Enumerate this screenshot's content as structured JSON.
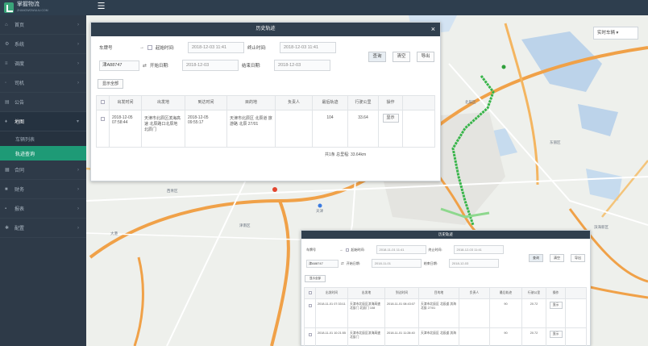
{
  "app": {
    "title": "掌握物流",
    "subtitle": "ZHANGWOWULIU.COM"
  },
  "sidebar": {
    "items": [
      {
        "label": "首页",
        "icon": "home-icon"
      },
      {
        "label": "系统",
        "icon": "gear-icon"
      },
      {
        "label": "调度",
        "icon": "dispatch-icon"
      },
      {
        "label": "司机",
        "icon": "user-icon"
      },
      {
        "label": "公告",
        "icon": "notice-icon"
      },
      {
        "label": "地图",
        "icon": "map-pin-icon"
      },
      {
        "label": "合同",
        "icon": "contract-icon"
      },
      {
        "label": "财务",
        "icon": "money-icon"
      },
      {
        "label": "报表",
        "icon": "report-icon"
      },
      {
        "label": "配置",
        "icon": "config-icon"
      }
    ],
    "sub_items": [
      {
        "label": "车辆列表"
      },
      {
        "label": "轨迹查询"
      }
    ]
  },
  "map": {
    "search_label": "实时车辆 ▾",
    "labels": [
      "天津",
      "津南区",
      "西青区",
      "北辰区",
      "东丽区",
      "大港",
      "滨海新区"
    ]
  },
  "dialog_main": {
    "title": "历史轨迹",
    "close": "×",
    "plate_label": "车牌号",
    "plate_value": "津A88747",
    "start_label": "起始时间:",
    "start_value": "2018-12-03 11:41",
    "end_label": "终止时间:",
    "end_value": "2018-12-03 11:41",
    "depart_label": "开始日期:",
    "depart_value": "2018-12-03",
    "arrive_label": "结束日期:",
    "arrive_value": "2018-12-03",
    "query_button": "查询",
    "clear_button": "清空",
    "export_button": "导出",
    "show_all_button": "显示全部",
    "columns": [
      "出发时间",
      "出发地",
      "到达时间",
      "目的地",
      "负责人",
      "最后轨迹",
      "行驶公里",
      "操作"
    ],
    "rows": [
      {
        "depart_time": "2018-12-05 07:58:44",
        "from": "天津市北辰区滨海高速 北辰路口北辰地 北辰门",
        "arrive_time": "2018-12-05 09:55:17",
        "to": "天津市北辰区 北辰道 旅游路 北辰 27/01",
        "owner": "",
        "last": "104",
        "km": "33.64",
        "action": "显示"
      }
    ],
    "summary": "共1条 总里程: 33.64km"
  },
  "dialog_second": {
    "title": "历史轨迹",
    "plate_label": "车牌号",
    "plate_value": "津A88747",
    "start_label": "起始时间:",
    "start_value": "2018-11-01 11:41",
    "end_label": "终止时间:",
    "end_value": "2018-12-03 11:41",
    "depart_label": "开始日期:",
    "depart_value": "2018-11-01",
    "arrive_label": "结束日期:",
    "arrive_value": "2018-12-03",
    "query_button": "查询",
    "clear_button": "清空",
    "export_button": "导出",
    "show_all_button": "显示全部",
    "columns": [
      "出发时间",
      "出发地",
      "到达时间",
      "目的地",
      "负责人",
      "最后轨迹",
      "行驶公里",
      "操作"
    ],
    "rows": [
      {
        "depart_time": "2018-11-01 07:33:11",
        "from": "天津市北辰区滨海高速 北辰门 北辰门 108",
        "arrive_time": "2018-11-01 08:43:07",
        "to": "天津市北辰区 北辰道 滨海 北辰 27/01",
        "owner": "",
        "last": "90",
        "km": "20.72",
        "action": "显示"
      },
      {
        "depart_time": "2018-11-01 10:21:55",
        "from": "天津市北辰区滨海高速 北辰门",
        "arrive_time": "2018-11-01 11:28:40",
        "to": "天津市北辰区 北辰道 滨海",
        "owner": "",
        "last": "90",
        "km": "20.72",
        "action": "显示"
      }
    ]
  }
}
